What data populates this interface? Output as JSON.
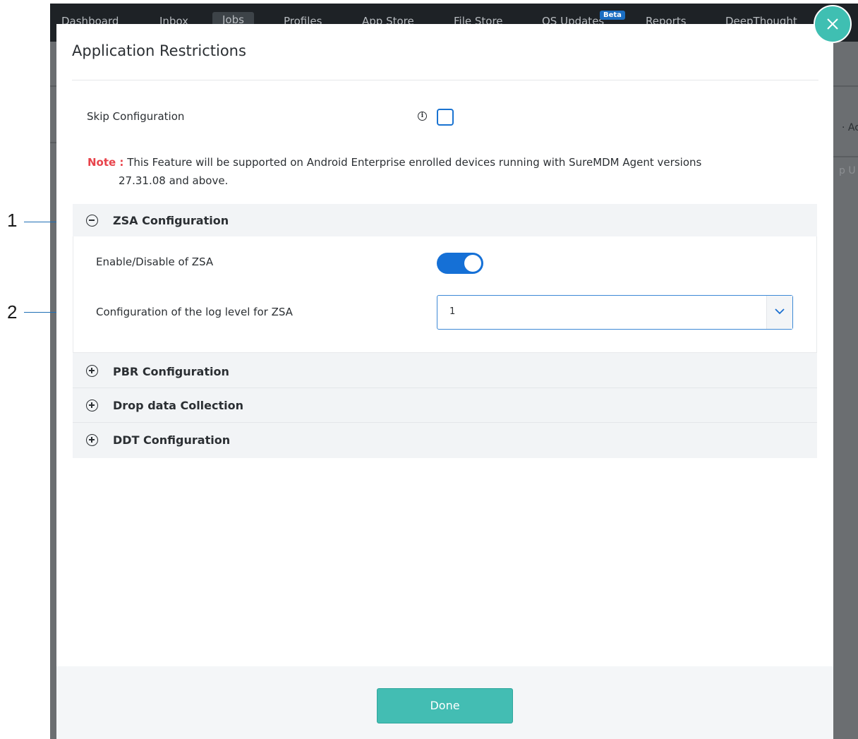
{
  "background_app": {
    "nav_items": [
      "Dashboard",
      "Inbox",
      "Jobs",
      "Profiles",
      "App Store",
      "File Store",
      "OS Updates",
      "Reports",
      "DeepThought"
    ],
    "beta_badge": "Beta",
    "side_text_1": "· Ac",
    "side_text_2": "p U"
  },
  "callouts": [
    "1",
    "2"
  ],
  "modal": {
    "title": "Application Restrictions",
    "skip_configuration": {
      "label": "Skip Configuration",
      "checked": false
    },
    "note": {
      "label": "Note :",
      "text": "This Feature will be supported on Android Enterprise enrolled devices running with SureMDM Agent versions",
      "text_cont": "27.31.08 and above."
    },
    "sections": [
      {
        "title": "ZSA Configuration",
        "expanded": true,
        "fields": {
          "enable_label": "Enable/Disable of ZSA",
          "enable_on": true,
          "log_level_label": "Configuration of the log level for ZSA",
          "log_level_value": "1"
        }
      },
      {
        "title": "PBR Configuration",
        "expanded": false
      },
      {
        "title": "Drop data Collection",
        "expanded": false
      },
      {
        "title": "DDT Configuration",
        "expanded": false
      }
    ],
    "done_label": "Done"
  },
  "colors": {
    "accent_teal": "#43bdb3",
    "toggle_blue": "#1570d6",
    "note_red": "#e8434b"
  }
}
